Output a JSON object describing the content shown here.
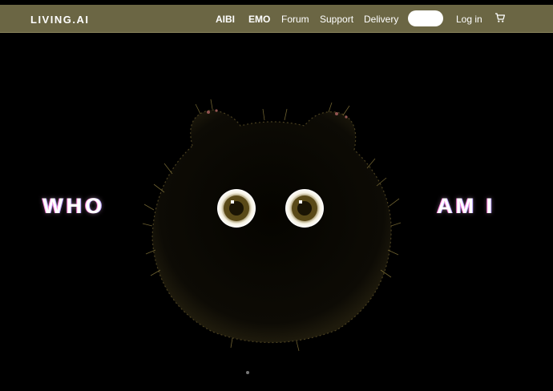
{
  "header": {
    "logo": "LIVING.AI",
    "nav": [
      {
        "label": "AIBI"
      },
      {
        "label": "EMO"
      },
      {
        "label": "Forum"
      },
      {
        "label": "Support"
      },
      {
        "label": "Delivery"
      }
    ],
    "login_label": "Log in",
    "cart_icon": "cart-icon"
  },
  "hero": {
    "left_text": "WHO",
    "right_text": "AM I"
  },
  "colors": {
    "nav_background": "#6b6644",
    "hero_background": "#000000",
    "text": "#ffffff"
  }
}
